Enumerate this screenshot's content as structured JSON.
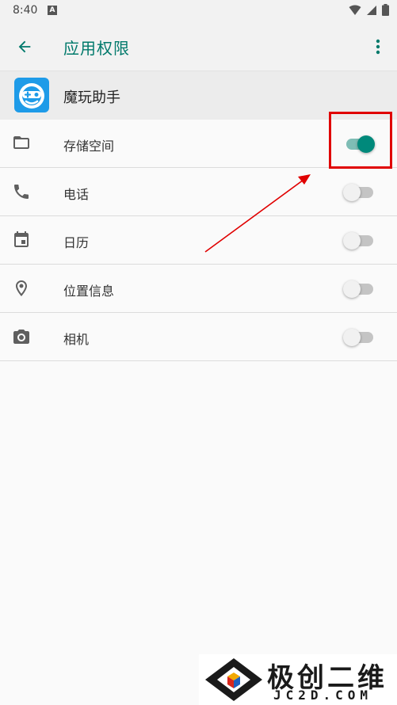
{
  "status_bar": {
    "time": "8:40",
    "notification_badge": "A",
    "icons": [
      "wifi-icon",
      "signal-icon",
      "battery-icon"
    ]
  },
  "app_bar": {
    "title": "应用权限",
    "back_icon": "arrow-back-icon",
    "more_icon": "more-vert-icon"
  },
  "app": {
    "name": "魔玩助手",
    "logo_icon": "app-logo-icon"
  },
  "permissions": [
    {
      "label": "存储空间",
      "icon": "folder-icon",
      "enabled": true
    },
    {
      "label": "电话",
      "icon": "phone-icon",
      "enabled": false
    },
    {
      "label": "日历",
      "icon": "calendar-icon",
      "enabled": false
    },
    {
      "label": "位置信息",
      "icon": "location-icon",
      "enabled": false
    },
    {
      "label": "相机",
      "icon": "camera-icon",
      "enabled": false
    }
  ],
  "annotation": {
    "highlight_color": "#e00000",
    "target": "存储空间 toggle"
  },
  "watermark": {
    "title": "极创二维",
    "subtitle": "JC2D.COM"
  },
  "colors": {
    "accent": "#00796b",
    "toggle_on_thumb": "#00897b",
    "toggle_on_track": "#7fbdb5",
    "app_logo": "#1e9be8"
  }
}
